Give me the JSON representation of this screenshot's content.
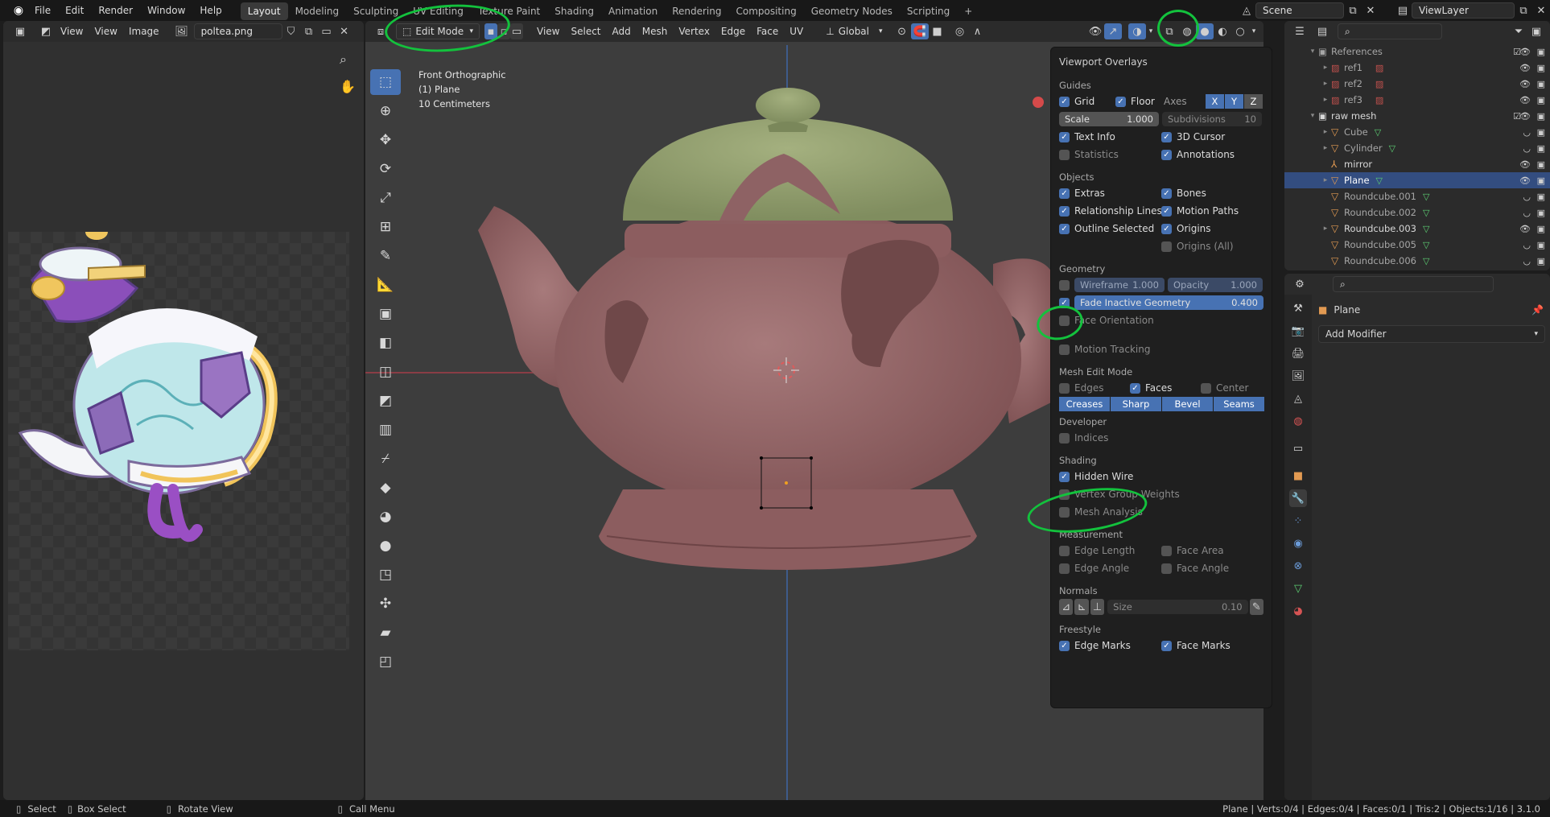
{
  "topbar": {
    "menus": [
      "File",
      "Edit",
      "Render",
      "Window",
      "Help"
    ],
    "workspaces": [
      "Layout",
      "Modeling",
      "Sculpting",
      "UV Editing",
      "Texture Paint",
      "Shading",
      "Animation",
      "Rendering",
      "Compositing",
      "Geometry Nodes",
      "Scripting"
    ],
    "active_workspace": "Layout",
    "add_workspace": "+",
    "scene": "Scene",
    "view_layer": "ViewLayer"
  },
  "image_editor": {
    "menus": [
      "View",
      "View",
      "Image"
    ],
    "image_name": "poltea.png"
  },
  "viewport": {
    "mode": "Edit Mode",
    "menus": [
      "View",
      "Select",
      "Add",
      "Mesh",
      "Vertex",
      "Edge",
      "Face",
      "UV"
    ],
    "orientation": "Global",
    "info_lines": [
      "Front Orthographic",
      "(1) Plane",
      "10 Centimeters"
    ]
  },
  "overlays": {
    "title": "Viewport Overlays",
    "guides": {
      "label": "Guides",
      "grid": "Grid",
      "floor": "Floor",
      "axes": "Axes",
      "axis_x": "X",
      "axis_y": "Y",
      "axis_z": "Z",
      "scale_label": "Scale",
      "scale_value": "1.000",
      "subdiv_label": "Subdivisions",
      "subdiv_value": "10",
      "text_info": "Text Info",
      "cursor_3d": "3D Cursor",
      "statistics": "Statistics",
      "annotations": "Annotations"
    },
    "objects": {
      "label": "Objects",
      "extras": "Extras",
      "bones": "Bones",
      "relationship_lines": "Relationship Lines",
      "motion_paths": "Motion Paths",
      "outline_selected": "Outline Selected",
      "origins": "Origins",
      "origins_all": "Origins (All)"
    },
    "geometry": {
      "label": "Geometry",
      "wireframe_label": "Wireframe",
      "wireframe_value": "1.000",
      "opacity_label": "Opacity",
      "opacity_value": "1.000",
      "fade_label": "Fade Inactive Geometry",
      "fade_value": "0.400",
      "face_orientation": "Face Orientation",
      "motion_tracking": "Motion Tracking"
    },
    "mesh_edit": {
      "label": "Mesh Edit Mode",
      "edges": "Edges",
      "faces": "Faces",
      "center": "Center",
      "buttons": [
        "Creases",
        "Sharp",
        "Bevel",
        "Seams"
      ]
    },
    "developer": {
      "label": "Developer",
      "indices": "Indices"
    },
    "shading": {
      "label": "Shading",
      "hidden_wire": "Hidden Wire",
      "vertex_group_weights": "Vertex Group Weights",
      "mesh_analysis": "Mesh Analysis"
    },
    "measurement": {
      "label": "Measurement",
      "edge_length": "Edge Length",
      "face_area": "Face Area",
      "edge_angle": "Edge Angle",
      "face_angle": "Face Angle"
    },
    "normals": {
      "label": "Normals",
      "size_label": "Size",
      "size_value": "0.10"
    },
    "freestyle": {
      "label": "Freestyle",
      "edge_marks": "Edge Marks",
      "face_marks": "Face Marks"
    }
  },
  "outliner": {
    "items": [
      {
        "label": "References"
      },
      {
        "label": "ref1"
      },
      {
        "label": "ref2"
      },
      {
        "label": "ref3"
      },
      {
        "label": "raw mesh"
      },
      {
        "label": "Cube"
      },
      {
        "label": "Cylinder"
      },
      {
        "label": "mirror"
      },
      {
        "label": "Plane"
      },
      {
        "label": "Roundcube.001"
      },
      {
        "label": "Roundcube.002"
      },
      {
        "label": "Roundcube.003"
      },
      {
        "label": "Roundcube.005"
      },
      {
        "label": "Roundcube.006"
      }
    ]
  },
  "properties": {
    "object_name": "Plane",
    "add_modifier": "Add Modifier"
  },
  "statusbar": {
    "select": "Select",
    "box_select": "Box Select",
    "rotate_view": "Rotate View",
    "call_menu": "Call Menu",
    "stats": "Plane | Verts:0/4 | Edges:0/4 | Faces:0/1 | Tris:2 | Objects:1/16 | 3.1.0"
  },
  "colors": {
    "accent": "#4772b3",
    "annotation": "#13c23d",
    "teapot_body": "#8c6061",
    "teapot_lid": "#8e9b6b"
  }
}
